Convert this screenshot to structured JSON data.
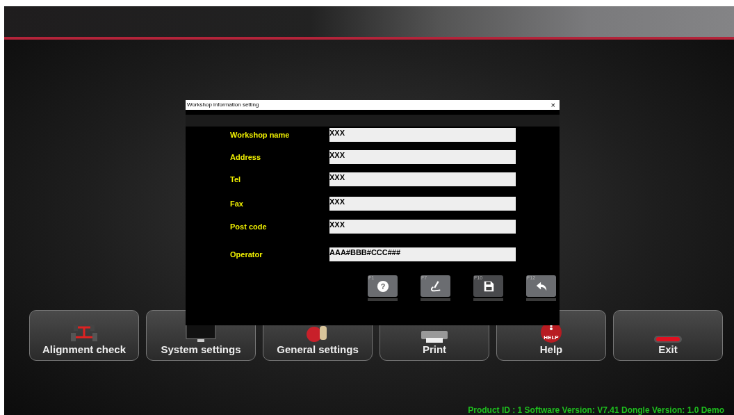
{
  "dialog": {
    "title": "Workshop information setting",
    "close": "×",
    "fields": [
      {
        "label": "Workshop name",
        "value": "XXX"
      },
      {
        "label": "Address",
        "value": "XXX"
      },
      {
        "label": "Tel",
        "value": "XXX"
      },
      {
        "label": "Fax",
        "value": "XXX"
      },
      {
        "label": "Post code",
        "value": "XXX"
      },
      {
        "label": "Operator",
        "value": "AAA#BBB#CCC###"
      }
    ],
    "buttons": [
      {
        "key": "F1",
        "kind": "help",
        "glyph": "?"
      },
      {
        "key": "F7",
        "kind": "edit"
      },
      {
        "key": "F10",
        "kind": "save"
      },
      {
        "key": "F12",
        "kind": "back"
      }
    ]
  },
  "menu": [
    {
      "label": "Alignment check",
      "kind": "alignment"
    },
    {
      "label": "System settings",
      "kind": "system"
    },
    {
      "label": "General settings",
      "kind": "general"
    },
    {
      "label": "Print",
      "kind": "print"
    },
    {
      "label": "Help",
      "kind": "help",
      "icon_text": "HELP"
    },
    {
      "label": "Exit",
      "kind": "exit"
    }
  ],
  "status_bar": "Product ID : 1  Software Version: V7.41 Dongle Version: 1.0 Demo"
}
